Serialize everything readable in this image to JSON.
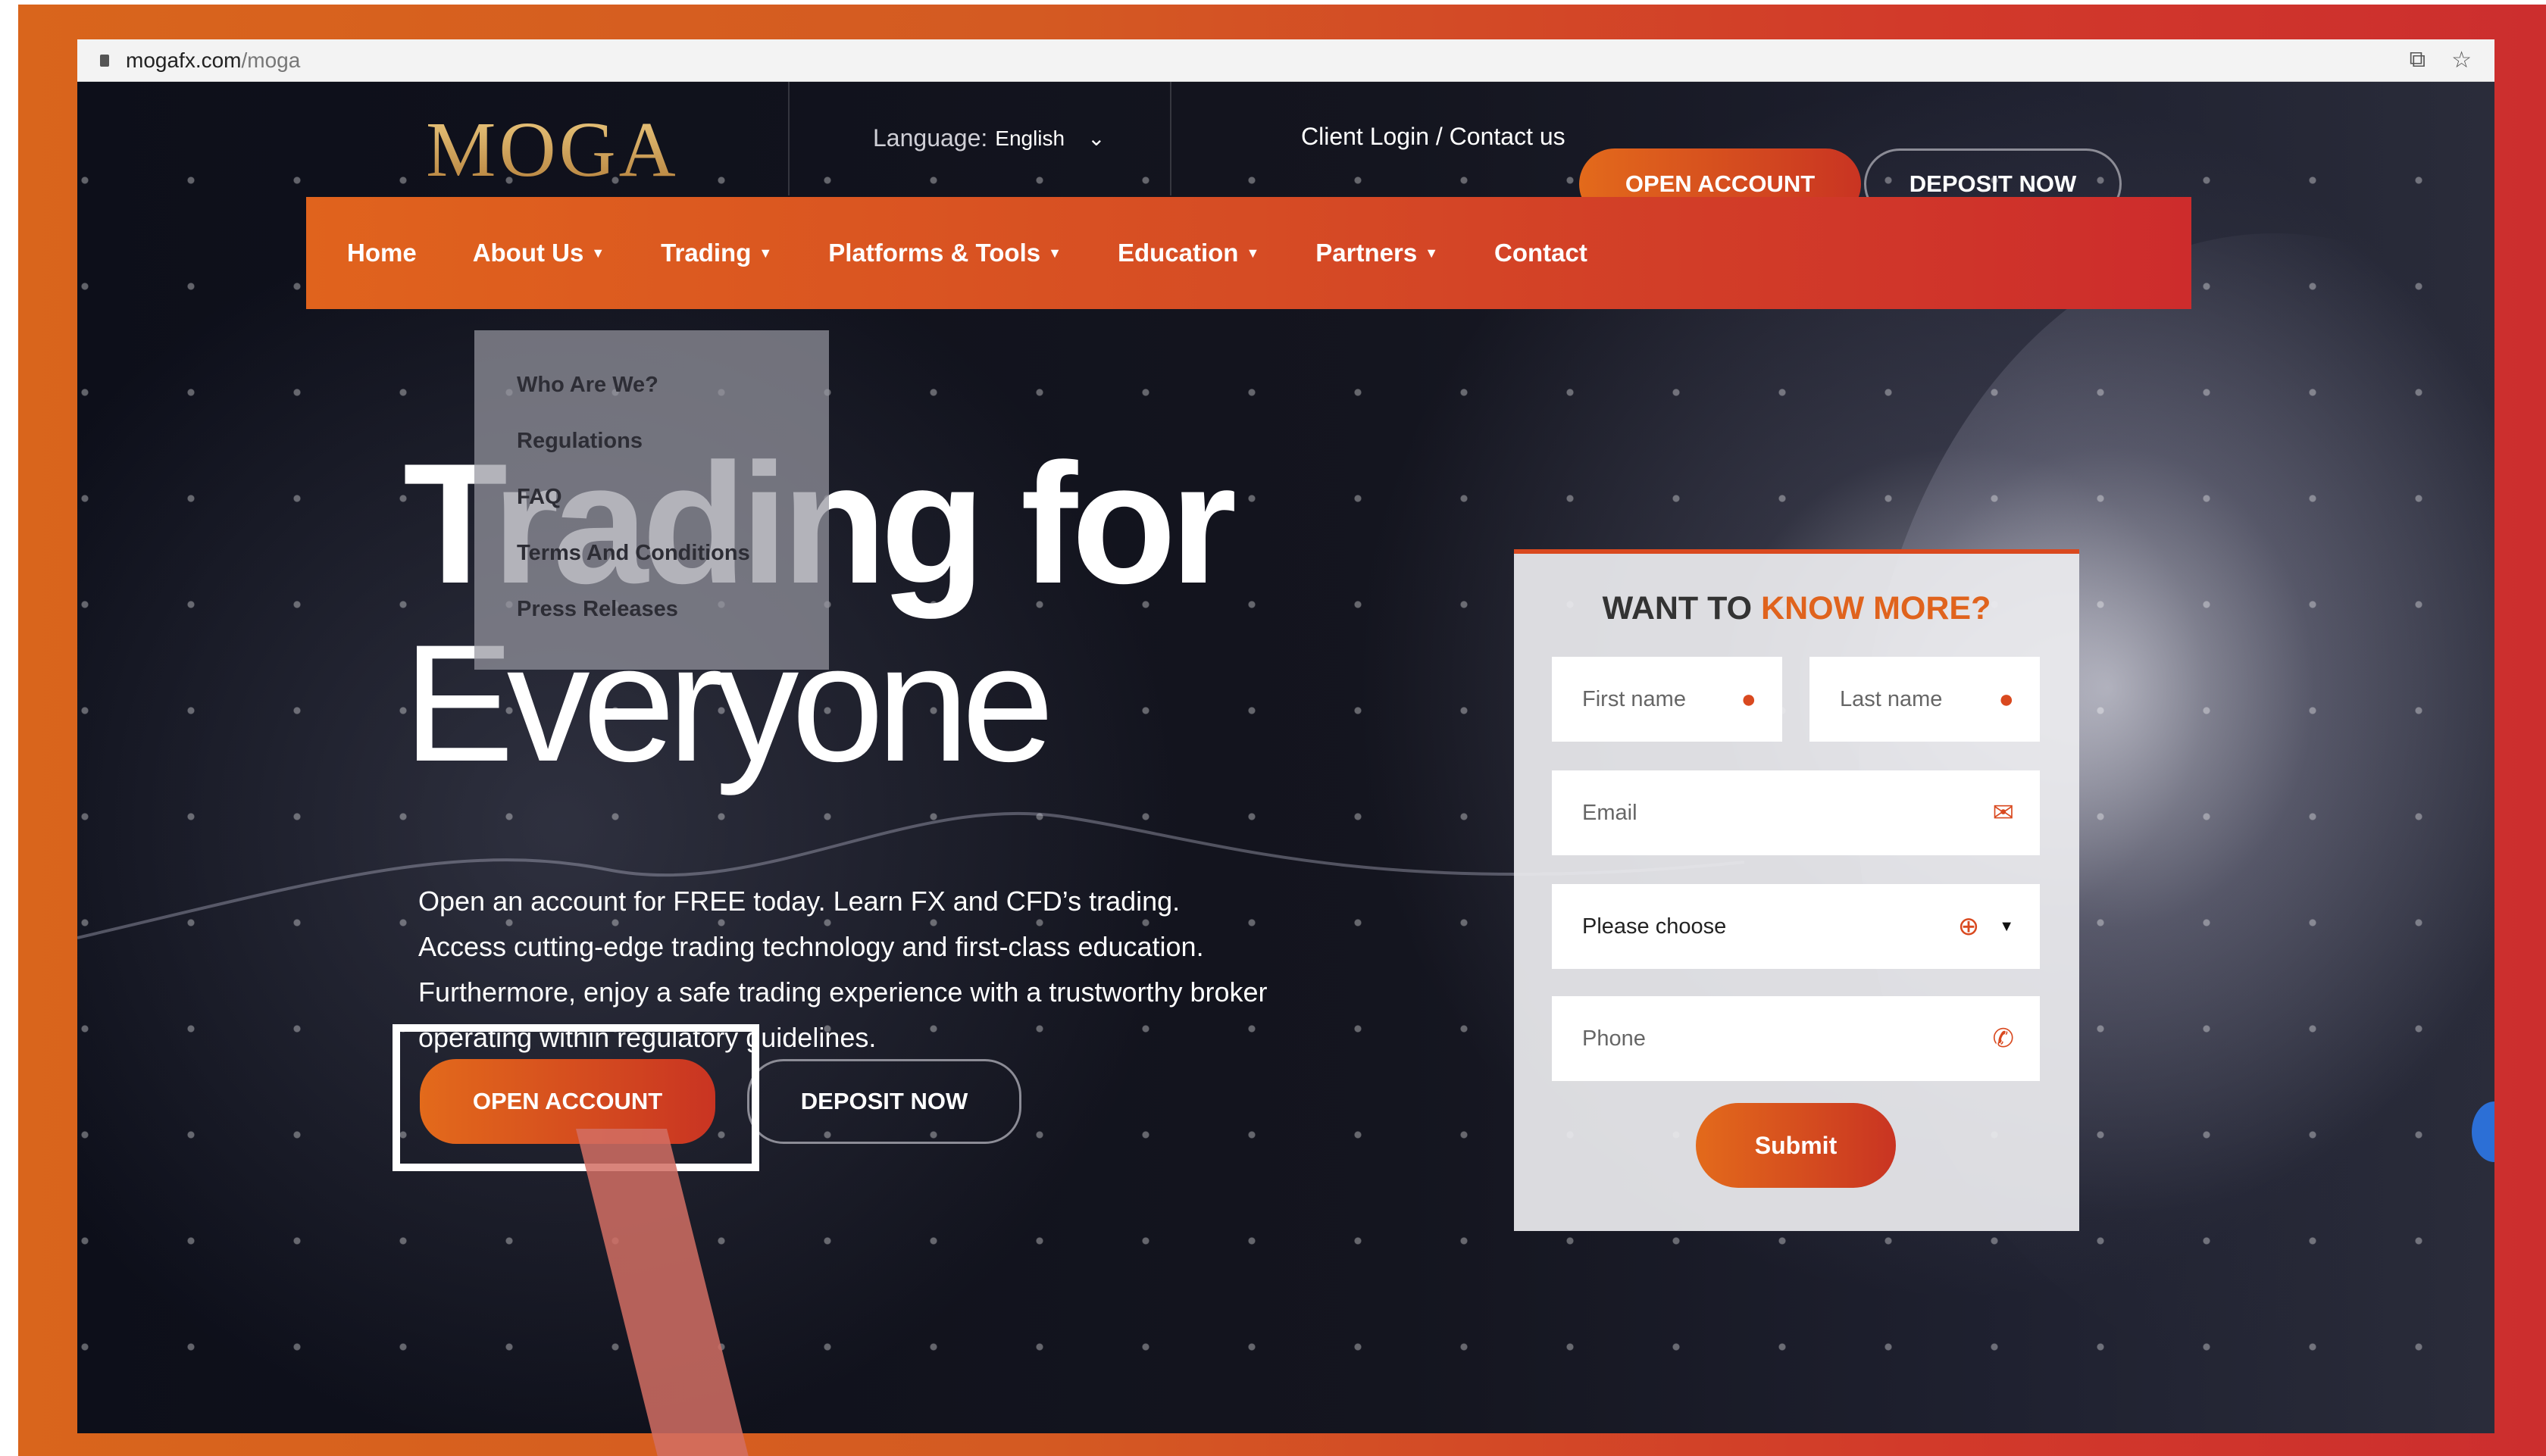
{
  "browser": {
    "url_host": "mogafx.com",
    "url_path": "/moga"
  },
  "header": {
    "logo": "MOGA",
    "language_label": "Language:",
    "language_value": "English",
    "client_link": "Client Login / Contact us",
    "open_account": "OPEN ACCOUNT",
    "deposit_now": "DEPOSIT NOW"
  },
  "nav": {
    "items": [
      "Home",
      "About Us",
      "Trading",
      "Platforms & Tools",
      "Education",
      "Partners",
      "Contact"
    ]
  },
  "dropdown": {
    "items": [
      "Who Are We?",
      "Regulations",
      "FAQ",
      "Terms And Conditions",
      "Press Releases"
    ]
  },
  "hero": {
    "title_line1": "Trading for",
    "title_line2": "Everyone",
    "text_lines": [
      "Open an account for FREE today. Learn FX and CFD’s trading.",
      "Access cutting-edge trading technology and first-class education.",
      "Furthermore, enjoy a safe trading experience with a trustworthy broker",
      "operating within regulatory guidelines."
    ],
    "open_account": "OPEN ACCOUNT",
    "deposit_now": "DEPOSIT NOW"
  },
  "form": {
    "title_plain": "WANT TO ",
    "title_accent": "KNOW MORE?",
    "first_name_placeholder": "First name",
    "last_name_placeholder": "Last name",
    "email_placeholder": "Email",
    "country_select": "Please choose",
    "phone_placeholder": "Phone",
    "submit": "Submit"
  },
  "colors": {
    "accent": "#e0631d",
    "accent_dark": "#c93422",
    "frame": "#d45a22"
  },
  "icons": {
    "user": "user-icon",
    "email": "envelope-icon",
    "globe": "globe-icon",
    "phone": "phone-icon"
  }
}
